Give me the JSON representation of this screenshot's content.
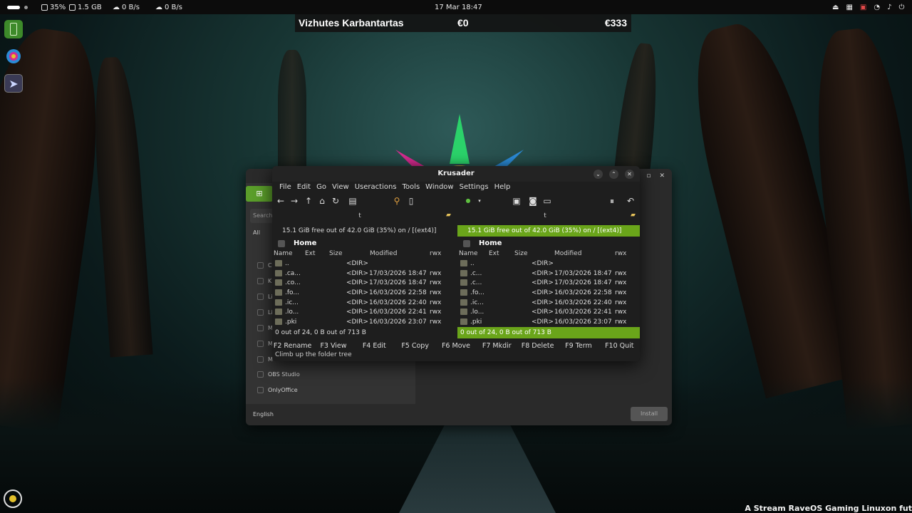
{
  "topbar": {
    "cpu": "35%",
    "memory": "1.5 GB",
    "net_down": "0 B/s",
    "net_up": "0 B/s",
    "clock": "17 Mar  18:47"
  },
  "banner": {
    "name": "Vizhutes Karbantartas",
    "value1": "€0",
    "value2": "€333"
  },
  "installer": {
    "search_placeholder": "Search",
    "filter_all": "All",
    "items": [
      "Cl",
      "Kl",
      "Li",
      "Li",
      "M",
      "M",
      "M",
      "OBS Studio",
      "OnlyOffice"
    ],
    "language": "English",
    "install_label": "Install"
  },
  "krusader": {
    "title": "Krusader",
    "menu": [
      "File",
      "Edit",
      "Go",
      "View",
      "Useractions",
      "Tools",
      "Window",
      "Settings",
      "Help"
    ],
    "left": {
      "tab": "t",
      "free": "15.1 GiB free out of 42.0 GiB (35%) on / [(ext4)]",
      "path": "Home",
      "columns": [
        "Name",
        "Ext",
        "Size",
        "Modified",
        "rwx"
      ],
      "rows": [
        {
          "name": "..",
          "size": "<DIR>",
          "modified": "",
          "rwx": ""
        },
        {
          "name": ".ca...",
          "size": "<DIR>",
          "modified": "17/03/2026 18:47",
          "rwx": "rwx"
        },
        {
          "name": ".co...",
          "size": "<DIR>",
          "modified": "17/03/2026 18:47",
          "rwx": "rwx"
        },
        {
          "name": ".fo...",
          "size": "<DIR>",
          "modified": "16/03/2026 22:58",
          "rwx": "rwx"
        },
        {
          "name": ".ic...",
          "size": "<DIR>",
          "modified": "16/03/2026 22:40",
          "rwx": "rwx"
        },
        {
          "name": ".lo...",
          "size": "<DIR>",
          "modified": "16/03/2026 22:41",
          "rwx": "rwx"
        },
        {
          "name": ".pki",
          "size": "<DIR>",
          "modified": "16/03/2026 23:07",
          "rwx": "rwx"
        }
      ],
      "status": "0 out of 24, 0 B out of 713 B"
    },
    "right": {
      "tab": "t",
      "free": "15.1 GiB free out of 42.0 GiB (35%) on / [(ext4)]",
      "path": "Home",
      "columns": [
        "Name",
        "Ext",
        "Size",
        "Modified",
        "rwx"
      ],
      "rows": [
        {
          "name": "..",
          "size": "<DIR>",
          "modified": "",
          "rwx": ""
        },
        {
          "name": ".c...",
          "size": "<DIR>",
          "modified": "17/03/2026 18:47",
          "rwx": "rwx"
        },
        {
          "name": ".c...",
          "size": "<DIR>",
          "modified": "17/03/2026 18:47",
          "rwx": "rwx"
        },
        {
          "name": ".fo...",
          "size": "<DIR>",
          "modified": "16/03/2026 22:58",
          "rwx": "rwx"
        },
        {
          "name": ".ic...",
          "size": "<DIR>",
          "modified": "16/03/2026 22:40",
          "rwx": "rwx"
        },
        {
          "name": ".lo...",
          "size": "<DIR>",
          "modified": "16/03/2026 22:41",
          "rwx": "rwx"
        },
        {
          "name": ".pki",
          "size": "<DIR>",
          "modified": "16/03/2026 23:07",
          "rwx": "rwx"
        }
      ],
      "status": "0 out of 24, 0 B out of 713 B"
    },
    "fkeys": [
      "F2 Rename",
      "F3 View",
      "F4 Edit",
      "F5 Copy",
      "F6 Move",
      "F7 Mkdir",
      "F8 Delete",
      "F9 Term",
      "F10 Quit"
    ],
    "hint": "Climb up the folder tree",
    "active_color": "#6aa51a"
  },
  "watermark": "A Stream RaveOS Gaming Linuxon fut"
}
